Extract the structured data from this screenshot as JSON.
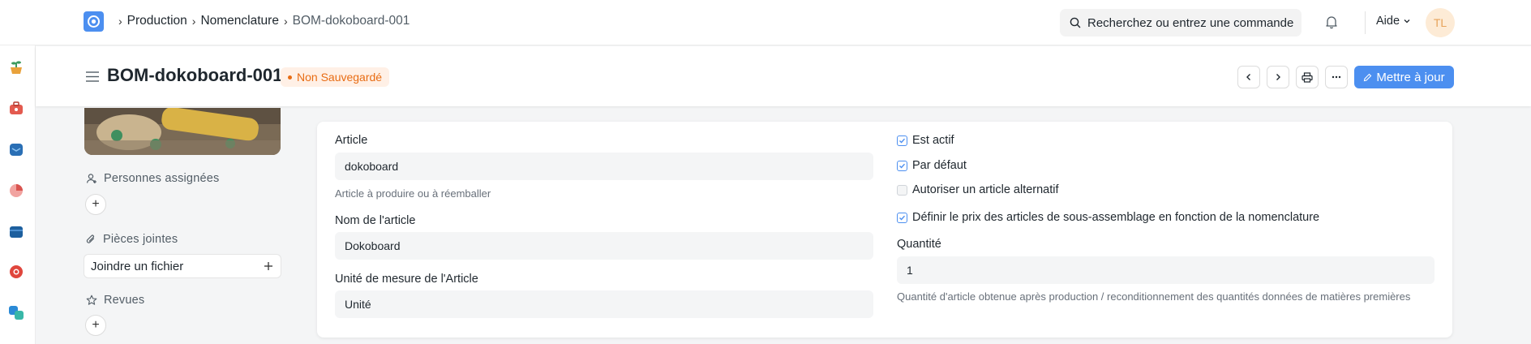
{
  "navbar": {
    "breadcrumbs": [
      "Production",
      "Nomenclature",
      "BOM-dokoboard-001"
    ],
    "search_placeholder": "Recherchez ou entrez une commande",
    "help_label": "Aide",
    "avatar_initials": "TL"
  },
  "page": {
    "title": "BOM-dokoboard-001",
    "status": "Non Sauvegardé",
    "primary_action": "Mettre à jour"
  },
  "sidebar": {
    "assigned_label": "Personnes assignées",
    "attachments_label": "Pièces jointes",
    "attach_button": "Joindre un fichier",
    "reviews_label": "Revues"
  },
  "form": {
    "item_label": "Article",
    "item_value": "dokoboard",
    "item_help": "Article à produire ou à réemballer",
    "item_name_label": "Nom de l'article",
    "item_name_value": "Dokoboard",
    "uom_label": "Unité de mesure de l'Article",
    "uom_value": "Unité",
    "is_active_label": "Est actif",
    "is_active": true,
    "is_default_label": "Par défaut",
    "is_default": true,
    "allow_alternative_label": "Autoriser un article alternatif",
    "allow_alternative": false,
    "set_rate_label": "Définir le prix des articles de sous-assemblage en fonction de la nomenclature",
    "set_rate": true,
    "quantity_label": "Quantité",
    "quantity_value": "1",
    "quantity_help": "Quantité d'article obtenue après production / reconditionnement des quantités données de matières premières"
  },
  "colors": {
    "primary": "#4c8ff0",
    "status_orange": "#e86c13"
  }
}
